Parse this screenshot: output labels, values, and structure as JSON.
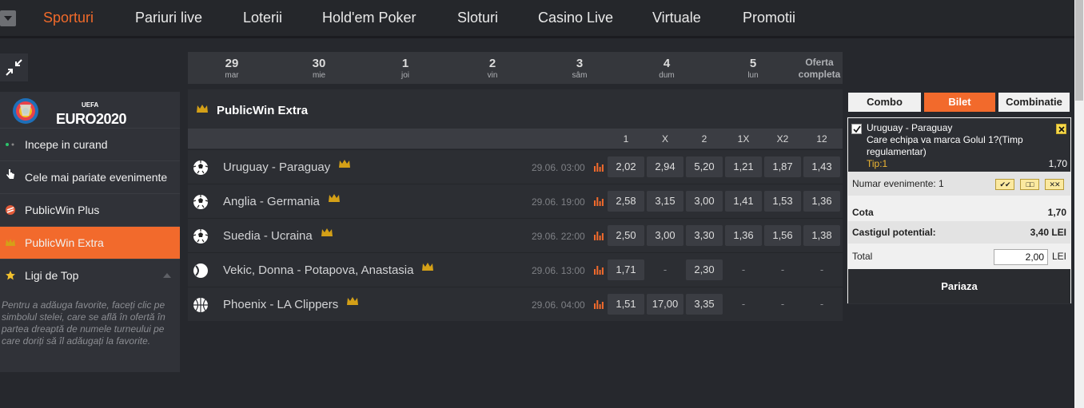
{
  "nav": {
    "items": [
      {
        "label": "Sporturi",
        "active": true
      },
      {
        "label": "Pariuri live"
      },
      {
        "label": "Loterii"
      },
      {
        "label": "Hold'em Poker"
      },
      {
        "label": "Sloturi"
      },
      {
        "label": "Casino Live"
      },
      {
        "label": "Virtuale"
      },
      {
        "label": "Promotii"
      }
    ]
  },
  "sidebar": {
    "logo": {
      "brand": "EURO2020",
      "org": "UEFA"
    },
    "items": [
      {
        "label": "Incepe in curand",
        "icon": "live-dots-icon"
      },
      {
        "label": "Cele mai pariate evenimente",
        "icon": "hand-pointer-icon"
      },
      {
        "label": "PublicWin Plus",
        "icon": "publicwin-plus-icon"
      },
      {
        "label": "PublicWin Extra",
        "icon": "crown-icon",
        "active": true
      },
      {
        "label": "Ligi de Top",
        "icon": "star-icon"
      }
    ],
    "note": "Pentru a adăuga favorite, faceți clic pe simbolul stelei, care se află în ofertă în partea dreaptă de numele turneului pe care doriți să îl adăugați la favorite."
  },
  "dates": [
    {
      "day": "29",
      "weekday": "mar"
    },
    {
      "day": "30",
      "weekday": "mie"
    },
    {
      "day": "1",
      "weekday": "joi"
    },
    {
      "day": "2",
      "weekday": "vin"
    },
    {
      "day": "3",
      "weekday": "sâm"
    },
    {
      "day": "4",
      "weekday": "dum"
    },
    {
      "day": "5",
      "weekday": "lun"
    },
    {
      "day": "Oferta",
      "weekday": "completa"
    }
  ],
  "events": {
    "title": "PublicWin Extra",
    "columns": [
      "1",
      "X",
      "2",
      "1X",
      "X2",
      "12"
    ],
    "rows": [
      {
        "sport": "football-icon",
        "name": "Uruguay - Paraguay",
        "time": "29.06. 03:00",
        "odds": [
          "2,02",
          "2,94",
          "5,20",
          "1,21",
          "1,87",
          "1,43"
        ]
      },
      {
        "sport": "football-icon",
        "name": "Anglia - Germania",
        "time": "29.06. 19:00",
        "odds": [
          "2,58",
          "3,15",
          "3,00",
          "1,41",
          "1,53",
          "1,36"
        ]
      },
      {
        "sport": "football-icon",
        "name": "Suedia - Ucraina",
        "time": "29.06. 22:00",
        "odds": [
          "2,50",
          "3,00",
          "3,30",
          "1,36",
          "1,56",
          "1,38"
        ]
      },
      {
        "sport": "tennis-icon",
        "name": "Vekic, Donna - Potapova, Anastasia",
        "time": "29.06. 13:00",
        "odds": [
          "1,71",
          "-",
          "2,30",
          "-",
          "-",
          "-"
        ]
      },
      {
        "sport": "basketball-icon",
        "name": "Phoenix - LA Clippers",
        "time": "29.06. 04:00",
        "odds": [
          "1,51",
          "17,00",
          "3,35",
          "-",
          "-",
          "-"
        ]
      }
    ]
  },
  "slip": {
    "tabs": [
      "Combo",
      "Bilet",
      "Combinatie"
    ],
    "active_tab": "Bilet",
    "selection": {
      "match": "Uruguay - Paraguay",
      "market_line1": "Care echipa va marca Golul 1?(Timp",
      "market_line2": "regulamentar)",
      "tip": "Tip:1",
      "odd": "1,70"
    },
    "events_count_label": "Numar evenimente: 1",
    "system_buttons": [
      "✔✔",
      "□□",
      "✕✕"
    ],
    "cota_label": "Cota",
    "cota_value": "1,70",
    "potential_label": "Castigul potential:",
    "potential_value": "3,40 LEI",
    "total_label": "Total",
    "total_value": "2,00",
    "currency": "LEI",
    "place_label": "Pariaza"
  },
  "colors": {
    "accent": "#f26a2c",
    "crown": "#d4a017",
    "background": "#26282d"
  }
}
